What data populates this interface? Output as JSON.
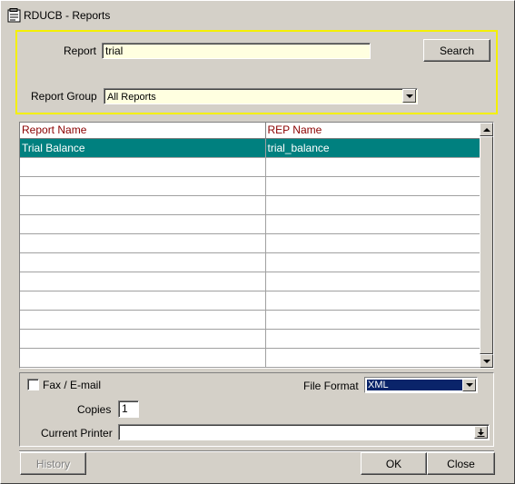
{
  "window": {
    "title": "RDUCB - Reports"
  },
  "search": {
    "report_label": "Report",
    "report_value": "trial",
    "group_label": "Report Group",
    "group_value": "All Reports",
    "search_button": "Search"
  },
  "grid": {
    "columns": [
      "Report Name",
      "REP Name"
    ],
    "rows": [
      [
        "Trial Balance",
        "trial_balance"
      ],
      [
        "",
        ""
      ],
      [
        "",
        ""
      ],
      [
        "",
        ""
      ],
      [
        "",
        ""
      ],
      [
        "",
        ""
      ],
      [
        "",
        ""
      ],
      [
        "",
        ""
      ],
      [
        "",
        ""
      ],
      [
        "",
        ""
      ],
      [
        "",
        ""
      ],
      [
        "",
        ""
      ]
    ],
    "selected_row": 0
  },
  "options": {
    "fax_label": "Fax / E-mail",
    "fax_checked": false,
    "file_format_label": "File Format",
    "file_format_value": "XML",
    "copies_label": "Copies",
    "copies_value": "1",
    "printer_label": "Current Printer",
    "printer_value": ""
  },
  "buttons": {
    "history": "History",
    "ok": "OK",
    "close": "Close"
  },
  "colors": {
    "selected_row": "#00807f",
    "header_text": "#8b0000",
    "search_panel_border": "#f4f000",
    "input_background": "#ffffe0"
  }
}
